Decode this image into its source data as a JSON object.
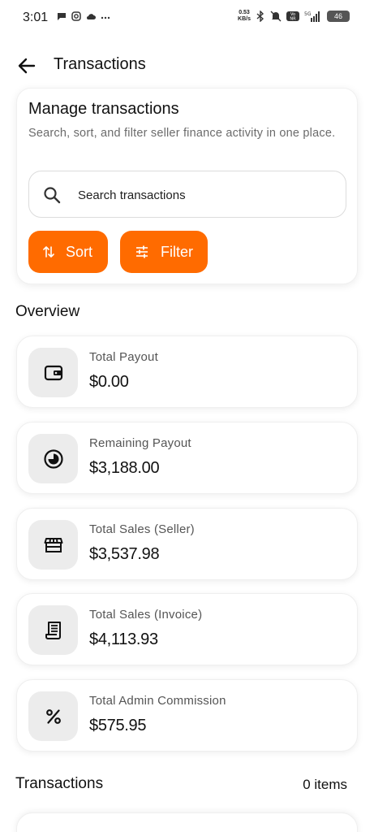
{
  "status_bar": {
    "time": "3:01",
    "net_speed_value": "0.53",
    "net_speed_unit": "KB/s",
    "battery": "46"
  },
  "app_bar": {
    "title": "Transactions"
  },
  "manage": {
    "title": "Manage transactions",
    "subtitle": "Search, sort, and filter seller finance activity in one place.",
    "search_placeholder": "Search transactions",
    "sort_label": "Sort",
    "filter_label": "Filter"
  },
  "overview": {
    "label": "Overview",
    "stats": [
      {
        "label": "Total Payout",
        "value": "$0.00",
        "icon": "wallet-icon"
      },
      {
        "label": "Remaining Payout",
        "value": "$3,188.00",
        "icon": "pie-progress-icon"
      },
      {
        "label": "Total Sales (Seller)",
        "value": "$3,537.98",
        "icon": "storefront-icon"
      },
      {
        "label": "Total Sales (Invoice)",
        "value": "$4,113.93",
        "icon": "receipt-icon"
      },
      {
        "label": "Total Admin Commission",
        "value": "$575.95",
        "icon": "percent-icon"
      }
    ]
  },
  "transactions": {
    "label": "Transactions",
    "count": "0 items"
  },
  "colors": {
    "accent": "#ff6b00",
    "icon_bg": "#ececec"
  }
}
